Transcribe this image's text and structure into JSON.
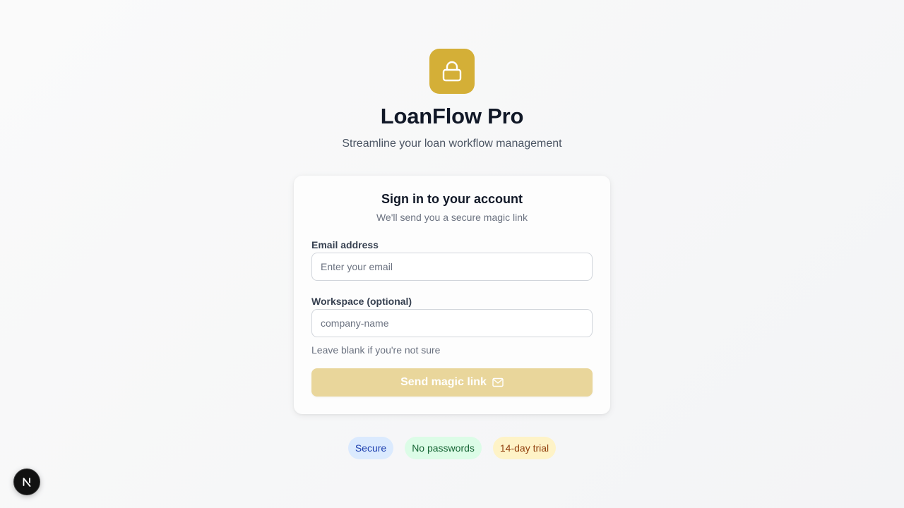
{
  "app": {
    "title": "LoanFlow Pro",
    "subtitle": "Streamline your loan workflow management",
    "logo_icon": "lock-icon",
    "brand_color": "#d4af37"
  },
  "card": {
    "title": "Sign in to your account",
    "subtitle": "We'll send you a secure magic link",
    "email": {
      "label": "Email address",
      "placeholder": "Enter your email",
      "value": ""
    },
    "workspace": {
      "label": "Workspace (optional)",
      "placeholder": "company-name",
      "value": "",
      "help": "Leave blank if you're not sure"
    },
    "submit": {
      "label": "Send magic link",
      "icon": "mail-icon",
      "disabled_color": "#e9d69b"
    }
  },
  "badges": [
    {
      "label": "Secure",
      "color": "#dbeafe"
    },
    {
      "label": "No passwords",
      "color": "#dcfce7"
    },
    {
      "label": "14-day trial",
      "color": "#fef3c7"
    }
  ],
  "devtools": {
    "icon": "nextjs-logo-icon"
  }
}
